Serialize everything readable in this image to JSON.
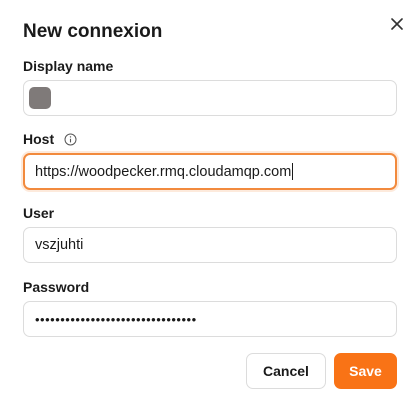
{
  "dialog": {
    "title": "New connexion",
    "close_icon": "close-icon"
  },
  "fields": {
    "display_name": {
      "label": "Display name",
      "value": "",
      "swatch_color": "#7f7a79"
    },
    "host": {
      "label": "Host",
      "info_icon": "info-icon",
      "value": "https://woodpecker.rmq.cloudamqp.com"
    },
    "user": {
      "label": "User",
      "value": "vszjuhti"
    },
    "password": {
      "label": "Password",
      "value": "••••••••••••••••••••••••••••••••"
    }
  },
  "actions": {
    "cancel_label": "Cancel",
    "save_label": "Save"
  },
  "colors": {
    "accent": "#f97316",
    "focus_border": "#f28a3d",
    "border": "#dcdcdc"
  }
}
